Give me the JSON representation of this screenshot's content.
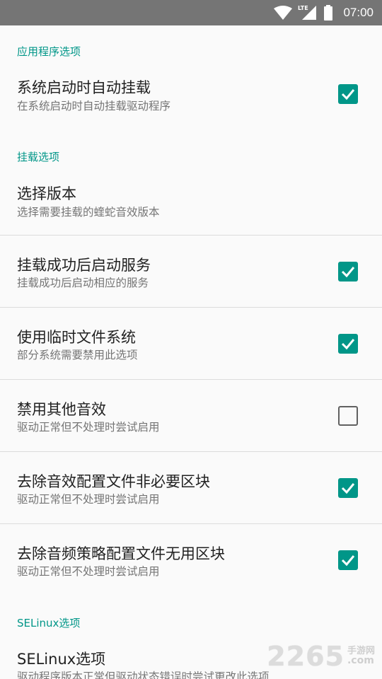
{
  "status_bar": {
    "time": "07:00",
    "network_label": "LTE",
    "icons": [
      "wifi-icon",
      "cellular-signal-icon",
      "battery-icon"
    ]
  },
  "sections": {
    "app_options": {
      "header": "应用程序选项"
    },
    "mount_options": {
      "header": "挂载选项"
    },
    "selinux_options": {
      "header": "SELinux选项"
    }
  },
  "prefs": {
    "auto_mount": {
      "title": "系统启动时自动挂载",
      "summary": "在系统启动时自动挂载驱动程序",
      "checked": true
    },
    "select_version": {
      "title": "选择版本",
      "summary": "选择需要挂载的蝰蛇音效版本"
    },
    "start_service": {
      "title": "挂载成功后启动服务",
      "summary": "挂载成功后启动相应的服务",
      "checked": true
    },
    "temp_fs": {
      "title": "使用临时文件系统",
      "summary": "部分系统需要禁用此选项",
      "checked": true
    },
    "disable_other_fx": {
      "title": "禁用其他音效",
      "summary": "驱动正常但不处理时尝试启用",
      "checked": false
    },
    "strip_fx_config": {
      "title": "去除音效配置文件非必要区块",
      "summary": "驱动正常但不处理时尝试启用",
      "checked": true
    },
    "strip_policy_config": {
      "title": "去除音频策略配置文件无用区块",
      "summary": "驱动正常但不处理时尝试启用",
      "checked": true
    },
    "selinux": {
      "title": "SELinux选项",
      "summary": "驱动程序版本正常但驱动状态错误时尝试更改此选项"
    }
  },
  "watermark": {
    "number": "2265",
    "site_cn": "手游网",
    "site_com": ".com"
  },
  "colors": {
    "accent": "#009688",
    "status_bar": "#757575",
    "background": "#fafafa"
  }
}
